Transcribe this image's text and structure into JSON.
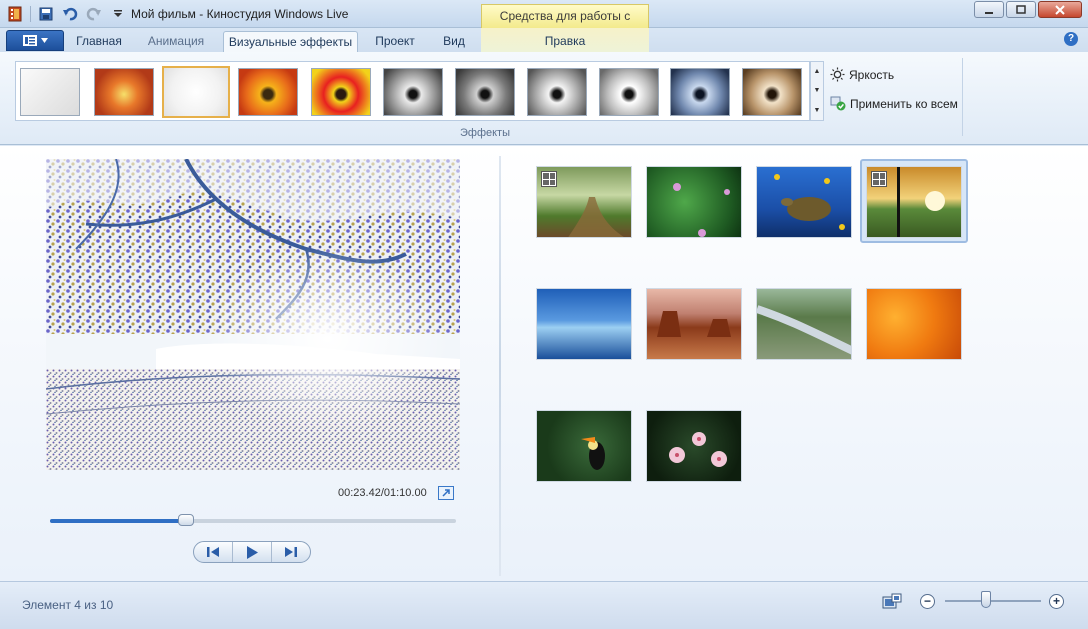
{
  "window": {
    "title": "Мой фильм - Киностудия Windows Live",
    "context_group": "Средства для работы с видео"
  },
  "tabs": [
    {
      "label": "Главная"
    },
    {
      "label": "Анимация"
    },
    {
      "label": "Визуальные эффекты",
      "active": true
    },
    {
      "label": "Проект"
    },
    {
      "label": "Вид"
    },
    {
      "label": "Правка",
      "contextual": true
    }
  ],
  "ribbon": {
    "group_label": "Эффекты",
    "brightness_label": "Яркость",
    "apply_all_label": "Применить ко всем",
    "effects": [
      "none",
      "warm",
      "selected",
      "orange",
      "red-yellow",
      "gray1",
      "gray2",
      "gray3",
      "gray4",
      "cyanotype",
      "sepia"
    ]
  },
  "preview": {
    "timecode": "00:23.42/01:10.00",
    "progress": 0.335
  },
  "storyboard": {
    "clips": [
      "forest-path",
      "green-flowers",
      "sea-turtle",
      "autumn-tree-sunset",
      "blue-sea",
      "desert-rock",
      "river",
      "orange-flowers",
      "toucan",
      "pink-flowers"
    ],
    "selected_index": 3
  },
  "status": {
    "text": "Элемент 4 из 10",
    "zoom": 0.42
  },
  "colors": {
    "accent": "#2f6fc4",
    "context_tab": "#f3ea8c"
  }
}
